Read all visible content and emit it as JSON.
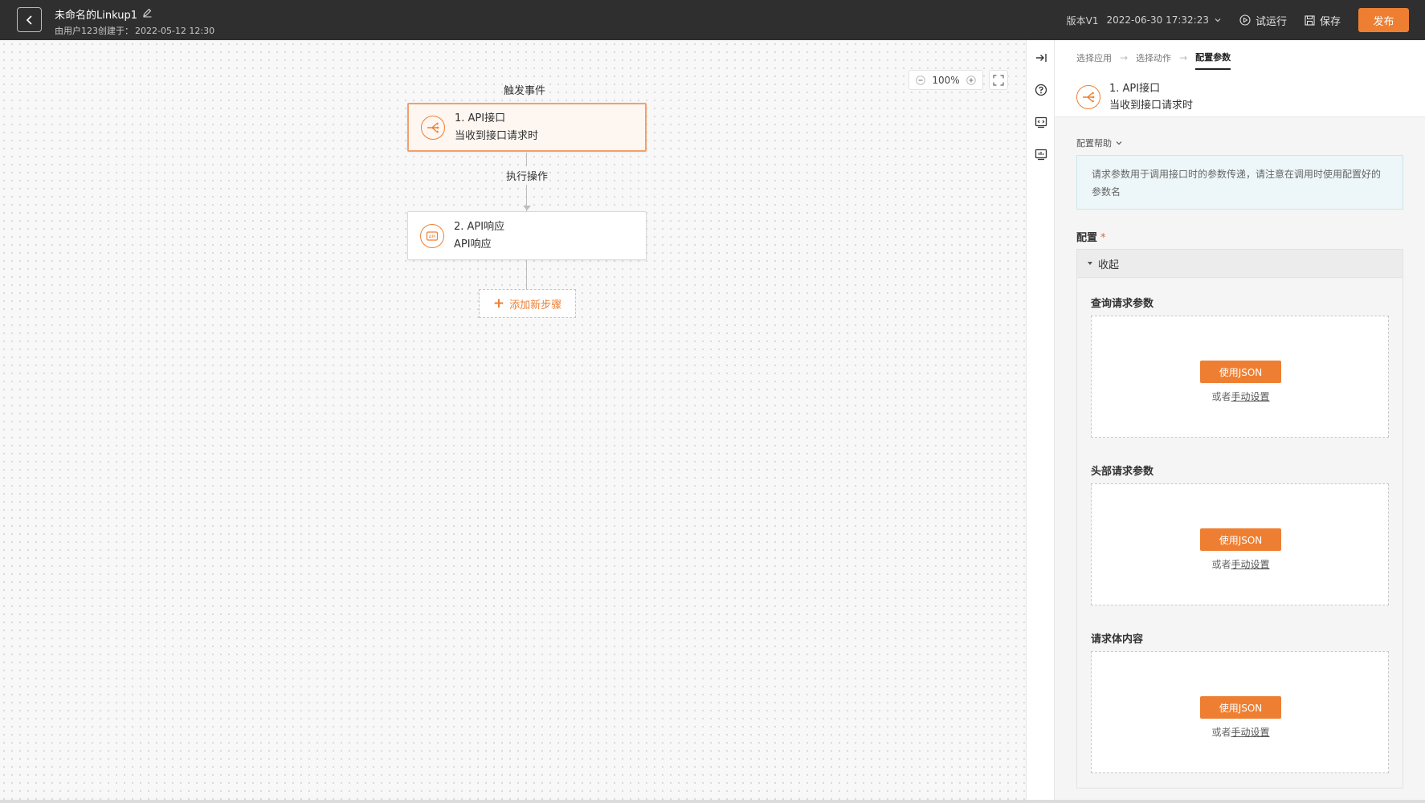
{
  "header": {
    "title": "未命名的Linkup1",
    "created_by": "由用户123创建于：",
    "created_at": "2022-05-12 12:30",
    "version": "版本V1",
    "version_time": "2022-06-30 17:32:23",
    "trial_run": "试运行",
    "save": "保存",
    "publish": "发布"
  },
  "canvas": {
    "zoom_level": "100%",
    "trigger_label": "触发事件",
    "action_label": "执行操作",
    "add_step": "添加新步骤",
    "nodes": [
      {
        "title": "1. API接口",
        "subtitle": "当收到接口请求时",
        "icon": "webhook-icon"
      },
      {
        "title": "2. API响应",
        "subtitle": "API响应",
        "icon": "api-icon"
      }
    ]
  },
  "panel": {
    "steps": [
      "选择应用",
      "选择动作",
      "配置参数"
    ],
    "node_title": "1. API接口",
    "node_subtitle": "当收到接口请求时",
    "help_toggle": "配置帮助",
    "help_text": "请求参数用于调用接口时的参数传递，请注意在调用时使用配置好的参数名",
    "config_label": "配置",
    "required_mark": "*",
    "collapse_label": "收起",
    "sections": [
      {
        "title": "查询请求参数",
        "button": "使用JSON",
        "or": "或者",
        "manual": "手动设置"
      },
      {
        "title": "头部请求参数",
        "button": "使用JSON",
        "or": "或者",
        "manual": "手动设置"
      },
      {
        "title": "请求体内容",
        "button": "使用JSON",
        "or": "或者",
        "manual": "手动设置"
      }
    ]
  },
  "colors": {
    "accent": "#ee7f32",
    "topbar": "#2f2f2f",
    "help_bg": "#edf6f8"
  }
}
